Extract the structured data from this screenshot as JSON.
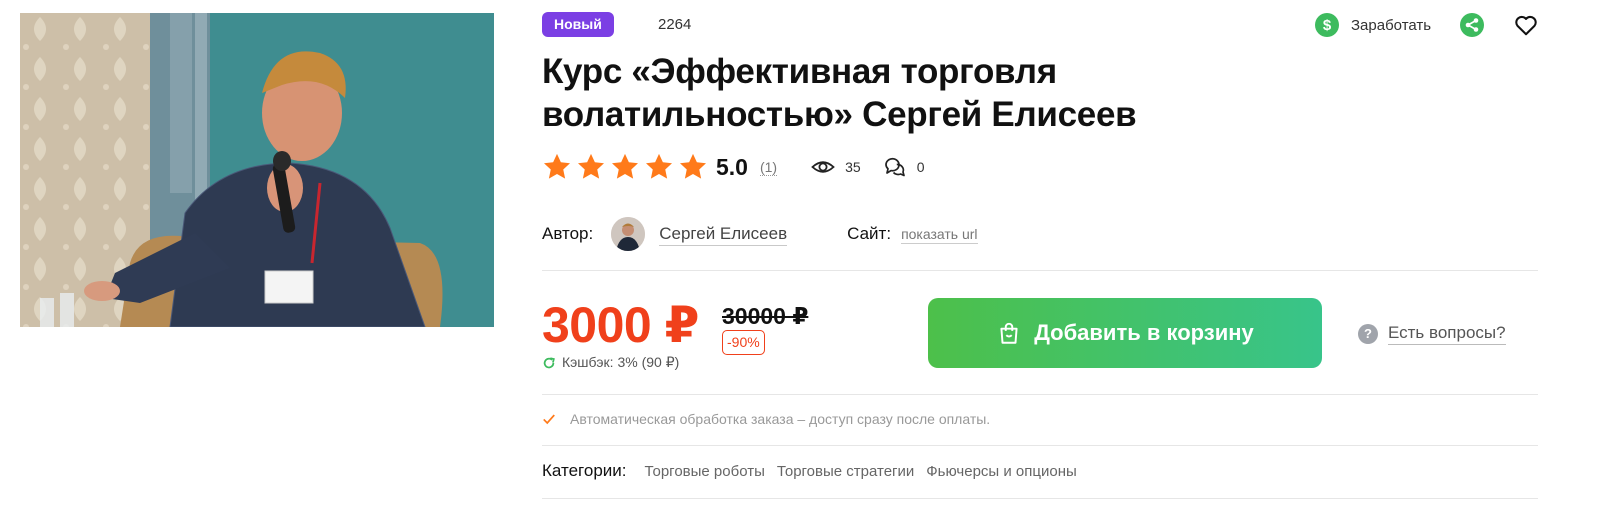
{
  "product": {
    "badge": "Новый",
    "id": "2264",
    "title": "Курс «Эффективная торговля волатильностью» Сергей Елисеев",
    "rating": {
      "stars": 5,
      "value": "5.0",
      "count": "(1)"
    },
    "views": "35",
    "comments": "0"
  },
  "header_actions": {
    "earn_label": "Заработать",
    "earn_icon_glyph": "$"
  },
  "author": {
    "label": "Автор:",
    "name": "Сергей Елисеев"
  },
  "site": {
    "label": "Сайт:",
    "link": "показать url"
  },
  "pricing": {
    "price": "3000 ₽",
    "old_price": "30000 ₽",
    "discount": "-90%",
    "cashback": "Кэшбэк: 3% (90 ₽)"
  },
  "cart": {
    "button_label": "Добавить в корзину"
  },
  "questions": {
    "icon_glyph": "?",
    "label": "Есть вопросы?"
  },
  "auto_note": "Автоматическая обработка заказа – доступ сразу после оплаты.",
  "categories": {
    "label": "Категории:",
    "items": [
      "Торговые роботы",
      "Торговые стратегии",
      "Фьючерсы и опционы"
    ]
  },
  "colors": {
    "badge": "#7b3fe4",
    "price": "#f0401b",
    "star": "#ff7a1a",
    "earn": "#3dbb5e",
    "cart_start": "#4dc04a",
    "cart_end": "#38c48a"
  },
  "icons": [
    "dollar-icon",
    "share-icon",
    "heart-icon",
    "star-icon",
    "eye-icon",
    "comments-icon",
    "refresh-icon",
    "shopping-bag-icon",
    "question-icon",
    "check-icon"
  ]
}
